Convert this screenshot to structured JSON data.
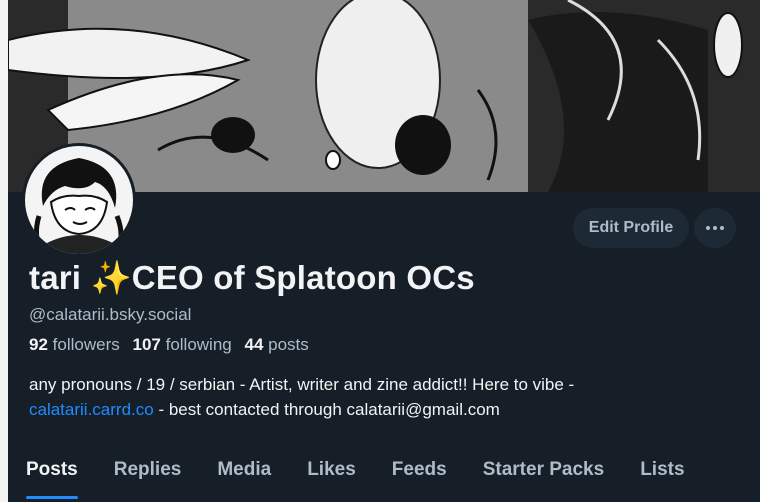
{
  "profile": {
    "display_name": "tari ✨CEO of Splatoon OCs",
    "handle": "@calatarii.bsky.social",
    "followers_count": "92",
    "followers_label": "followers",
    "following_count": "107",
    "following_label": "following",
    "posts_count": "44",
    "posts_label": "posts",
    "bio_line1": "any pronouns / 19 / serbian - Artist, writer and zine addict!! Here to vibe -",
    "bio_link": "calatarii.carrd.co",
    "bio_line2": " - best contacted through calatarii@gmail.com"
  },
  "actions": {
    "edit_profile_label": "Edit Profile",
    "more_icon": "ellipsis-icon"
  },
  "tabs": [
    {
      "label": "Posts",
      "active": true
    },
    {
      "label": "Replies",
      "active": false
    },
    {
      "label": "Media",
      "active": false
    },
    {
      "label": "Likes",
      "active": false
    },
    {
      "label": "Feeds",
      "active": false
    },
    {
      "label": "Starter Packs",
      "active": false
    },
    {
      "label": "Lists",
      "active": false
    }
  ],
  "colors": {
    "background": "#161e27",
    "accent": "#208bfe",
    "muted_text": "#aebbc9",
    "button_bg": "#1e2936"
  }
}
